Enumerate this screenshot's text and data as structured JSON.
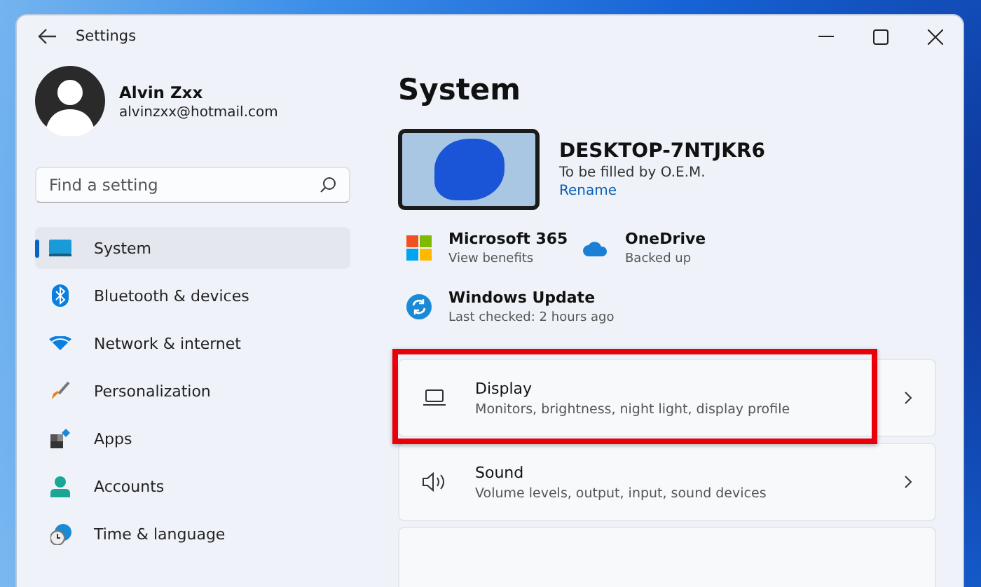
{
  "window": {
    "title": "Settings"
  },
  "account": {
    "name": "Alvin Zxx",
    "email": "alvinzxx@hotmail.com"
  },
  "search": {
    "placeholder": "Find a setting"
  },
  "sidebar": {
    "items": [
      {
        "label": "System",
        "selected": true
      },
      {
        "label": "Bluetooth & devices",
        "selected": false
      },
      {
        "label": "Network & internet",
        "selected": false
      },
      {
        "label": "Personalization",
        "selected": false
      },
      {
        "label": "Apps",
        "selected": false
      },
      {
        "label": "Accounts",
        "selected": false
      },
      {
        "label": "Time & language",
        "selected": false
      }
    ]
  },
  "page": {
    "title": "System",
    "device": {
      "name": "DESKTOP-7NTJKR6",
      "subtitle": "To be filled by O.E.M.",
      "link": "Rename"
    },
    "tiles": [
      {
        "title": "Microsoft 365",
        "subtitle": "View benefits"
      },
      {
        "title": "OneDrive",
        "subtitle": "Backed up"
      },
      {
        "title": "Windows Update",
        "subtitle": "Last checked: 2 hours ago"
      }
    ],
    "cards": [
      {
        "title": "Display",
        "subtitle": "Monitors, brightness, night light, display profile",
        "highlighted": true
      },
      {
        "title": "Sound",
        "subtitle": "Volume levels, output, input, sound devices",
        "highlighted": false
      }
    ]
  }
}
